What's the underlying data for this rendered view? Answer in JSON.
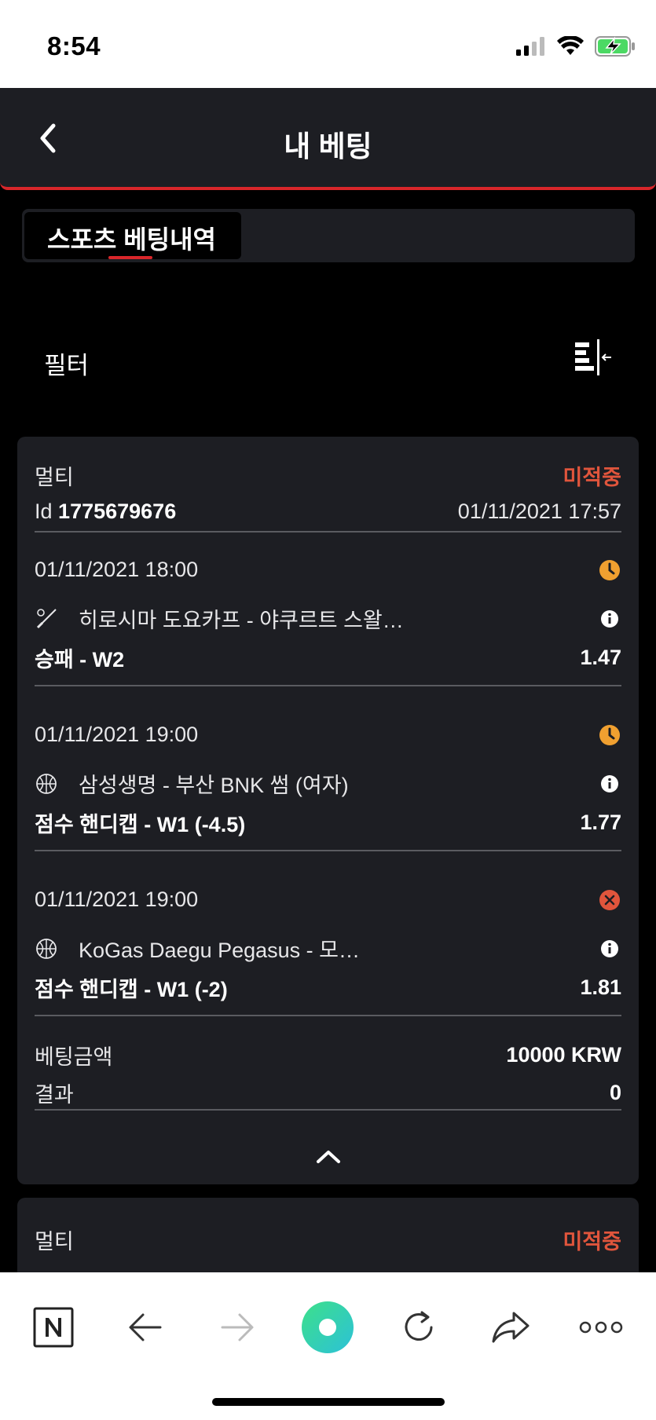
{
  "status_bar": {
    "time": "8:54"
  },
  "header": {
    "title": "내 베팅"
  },
  "tabs": {
    "active_label": "스포츠 베팅내역"
  },
  "filter": {
    "label": "필터"
  },
  "bet": {
    "type": "멀티",
    "status": "미적중",
    "id_prefix": "Id",
    "id_value": "1775679676",
    "placed_at": "01/11/2021 17:57",
    "events": [
      {
        "datetime": "01/11/2021 18:00",
        "status_icon": "clock-icon",
        "sport_icon": "baseball-icon",
        "match": "히로시마 도요카프 - 야쿠르트 스왈…",
        "market": "승패 - W2",
        "odds": "1.47"
      },
      {
        "datetime": "01/11/2021 19:00",
        "status_icon": "clock-icon",
        "sport_icon": "basketball-icon",
        "match": "삼성생명 - 부산 BNK 썸 (여자)",
        "market": "점수 핸디캡 - W1 (-4.5)",
        "odds": "1.77"
      },
      {
        "datetime": "01/11/2021 19:00",
        "status_icon": "lost-x-icon",
        "sport_icon": "basketball-icon",
        "match": "KoGas Daegu Pegasus - 모…",
        "market": "점수 핸디캡 - W1 (-2)",
        "odds": "1.81"
      }
    ],
    "stake_label": "베팅금액",
    "stake_value": "10000 KRW",
    "result_label": "결과",
    "result_value": "0"
  },
  "next_bet": {
    "type": "멀티",
    "status": "미적중"
  },
  "colors": {
    "accent_red": "#d8262a",
    "lost_red": "#e0553c",
    "pending_orange": "#f0a030",
    "card_bg": "#1d1e23"
  }
}
